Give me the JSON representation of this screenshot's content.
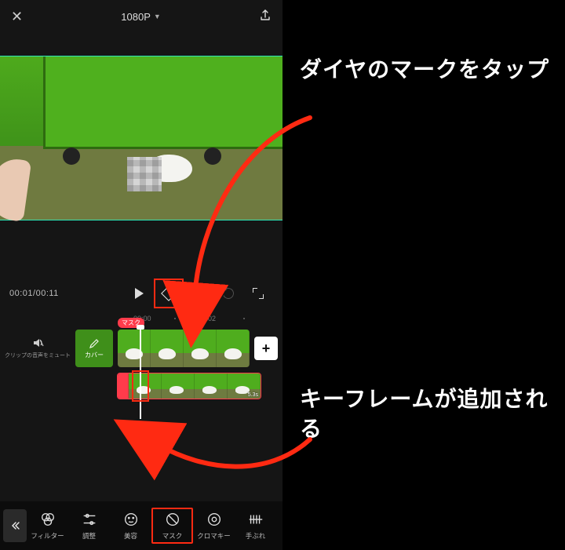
{
  "topbar": {
    "resolution": "1080P"
  },
  "playback": {
    "timecode": "00:01/00:11"
  },
  "ruler": {
    "t0": "00:00",
    "t1": "00:02"
  },
  "mute": {
    "label": "クリップの音声をミュート"
  },
  "cover": {
    "label": "カバー"
  },
  "lower_track": {
    "badge": "マスク",
    "end": "5.3s"
  },
  "tools": {
    "filter": "フィルター",
    "adjust": "調整",
    "beauty": "美容",
    "mask": "マスク",
    "chroma": "クロマキー",
    "stabilize": "手ぶれ"
  },
  "annotations": {
    "tap_diamond": "ダイヤのマークをタップ",
    "keyframe_added": "キーフレームが追加される"
  }
}
